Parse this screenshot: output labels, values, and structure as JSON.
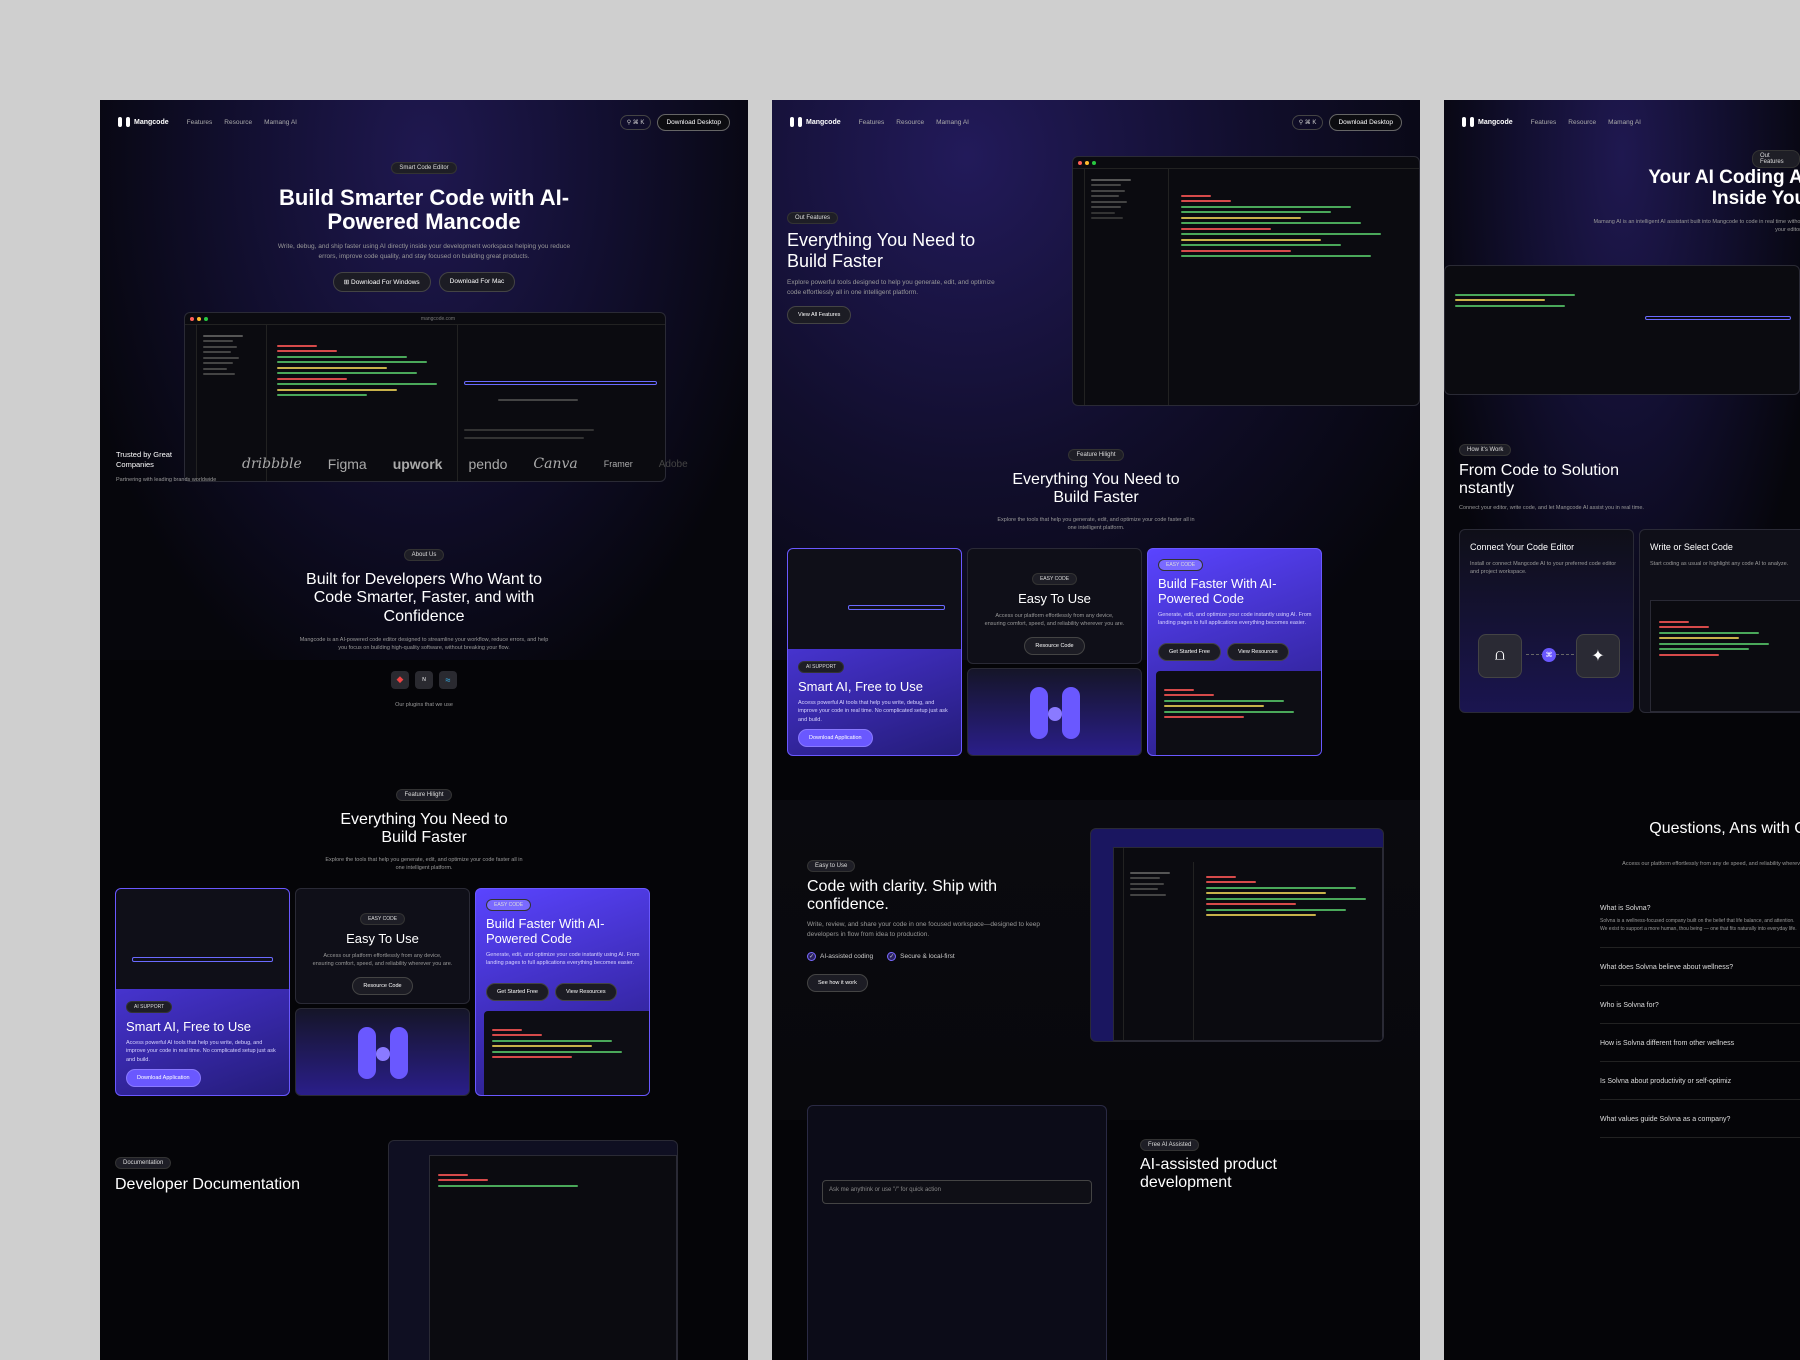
{
  "nav": {
    "brand": "Mangcode",
    "links": [
      "Features",
      "Resource",
      "Mamang AI"
    ],
    "kbd": "⌘ K",
    "download": "Download Desktop"
  },
  "panel1": {
    "pill": "Smart Code Editor",
    "title": "Build Smarter Code with AI-Powered Mancode",
    "subtitle": "Write, debug, and ship faster using AI directly inside your development workspace helping you reduce errors, improve code quality, and stay focused on building great products.",
    "btn_windows": "Download For Windows",
    "btn_mac": "Download For Mac",
    "url": "mangcode.com",
    "trusted_title": "Trusted by Great Companies",
    "trusted_sub": "Partnering with leading brands worldwide",
    "brands": [
      "dribbble",
      "Figma",
      "upwork",
      "pendo",
      "Canva",
      "Framer",
      "Adobe"
    ],
    "about_pill": "About Us",
    "about_title": "Built for Developers Who Want to Code Smarter, Faster, and with Confidence",
    "about_sub": "Mangcode is an AI-powered code editor designed to streamline your workflow, reduce errors, and help you focus on building high-quality software, without breaking your flow.",
    "plugins_caption": "Our plugins that we use",
    "feat_pill": "Feature Hilight",
    "feat_title": "Everything You Need to Build Faster",
    "feat_sub": "Explore the tools that help you generate, edit, and optimize your code faster all in one intelligent platform.",
    "card_ai_tag": "AI SUPPORT",
    "card_ai_title": "Smart AI, Free to Use",
    "card_ai_sub": "Access powerful AI tools that help you write, debug, and improve your code in real time. No complicated setup just ask and build.",
    "card_ai_btn": "Download Application",
    "card_easy_tag": "EASY CODE",
    "card_easy_title": "Easy To Use",
    "card_easy_sub": "Access our platform effortlessly from any device, ensuring comfort, speed, and reliability wherever you are.",
    "card_easy_btn": "Resource Code",
    "card_build_tag": "EASY CODE",
    "card_build_title": "Build Faster With AI-Powered Code",
    "card_build_sub": "Generate, edit, and optimize your code instantly using AI. From landing pages to full applications everything becomes easier.",
    "card_build_btn1": "Get Started Free",
    "card_build_btn2": "View Resources",
    "doc_pill": "Documentation",
    "doc_title": "Developer Documentation"
  },
  "panel2": {
    "pill": "Out Features",
    "title": "Everything You Need to Build Faster",
    "subtitle": "Explore powerful tools designed to help you generate, edit, and optimize code effortlessly all in one intelligent platform.",
    "btn": "View All Features",
    "feat_pill": "Feature Hilight",
    "feat_title": "Everything You Need to Build Faster",
    "feat_sub": "Explore the tools that help you generate, edit, and optimize your code faster all in one intelligent platform.",
    "easy_pill": "Easy to Use",
    "easy_title": "Code with clarity. Ship with confidence.",
    "easy_sub": "Write, review, and share your code in one focused workspace—designed to keep developers in flow from idea to production.",
    "check1": "AI-assisted coding",
    "check2": "Secure & local-first",
    "easy_btn": "See how it work",
    "input_placeholder": "Ask me anythink or use \"/\" for quick action",
    "ai_pill": "Free AI Assisted",
    "ai_title": "AI-assisted product development"
  },
  "panel3": {
    "pill": "Out Features",
    "title": "Your AI Coding Ass Inside Your I",
    "subtitle": "Mamang AI is an intelligent AI assistant built into Mangcode to code in real time without leaving your editor. Designe",
    "how_pill": "How it's Work",
    "how_title": "From Code to Solution nstantly",
    "how_sub": "Connect your editor, write code, and let Mangcode AI assist you in real time.",
    "step1_title": "Connect Your Code Editor",
    "step1_sub": "Install or connect Mangcode AI to your preferred code editor and project workspace.",
    "step2_title": "Write or Select Code",
    "step2_sub": "Start coding as usual or highlight any code AI to analyze.",
    "faq_title": "Questions, Ans with Car",
    "faq_sub": "Access our platform effortlessly from any de speed, and reliability wherev",
    "faq": [
      {
        "q": "What is Solvna?",
        "a": "Solvna is a wellness-focused company built on the belief that life balance, and attention. We exist to support a more human, thou being — one that fits naturally into everyday life."
      },
      {
        "q": "What does Solvna believe about wellness?",
        "a": ""
      },
      {
        "q": "Who is Solvna for?",
        "a": ""
      },
      {
        "q": "How is Solvna different from other wellness",
        "a": ""
      },
      {
        "q": "Is Solvna about productivity or self-optimiz",
        "a": ""
      },
      {
        "q": "What values guide Solvna as a company?",
        "a": ""
      }
    ]
  },
  "colors": {
    "accent": "#5a44ff",
    "bg": "#050508",
    "outer": "#cfcfcf"
  }
}
